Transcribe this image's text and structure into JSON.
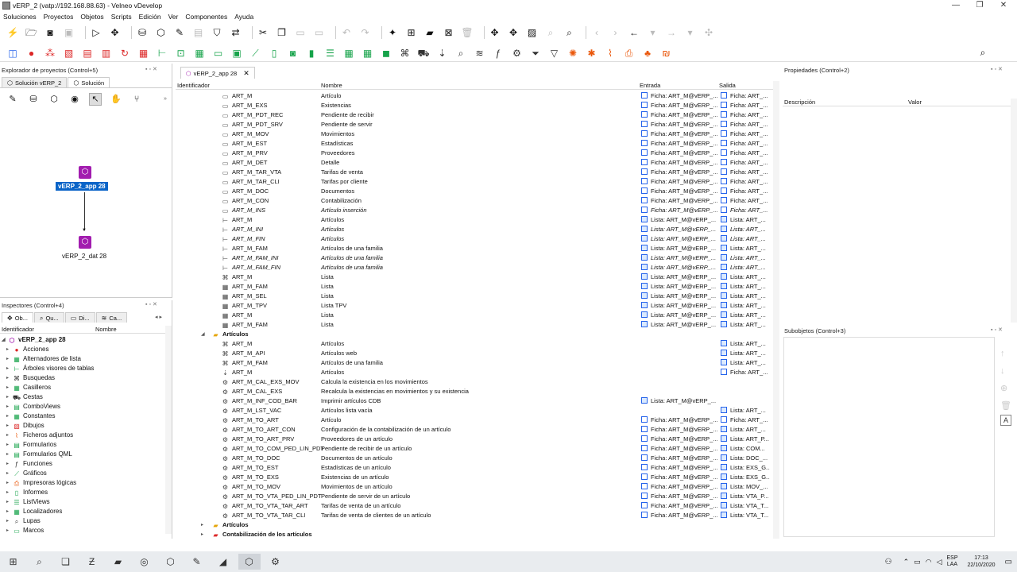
{
  "window": {
    "title": "vERP_2 (vatp://192.168.88.63) - Velneo vDevelop",
    "minimize": "—",
    "maximize": "❐",
    "close": "✕"
  },
  "menu": [
    "Soluciones",
    "Proyectos",
    "Objetos",
    "Scripts",
    "Edición",
    "Ver",
    "Componentes",
    "Ayuda"
  ],
  "toolbar1": [
    {
      "n": "lightning-icon",
      "g": "⚡"
    },
    {
      "n": "folder-open-icon",
      "g": "🗁"
    },
    {
      "n": "camera-icon",
      "g": "◙"
    },
    {
      "n": "save-all-icon",
      "g": "▣",
      "d": true
    },
    {
      "n": "sep"
    },
    {
      "n": "play-icon",
      "g": "▷"
    },
    {
      "n": "puzzle-icon",
      "g": "✥"
    },
    {
      "n": "sep"
    },
    {
      "n": "database-icon",
      "g": "⛁"
    },
    {
      "n": "hexagon-icon",
      "g": "⬡"
    },
    {
      "n": "edit-icon",
      "g": "✎"
    },
    {
      "n": "disk-icon",
      "g": "▤",
      "d": true
    },
    {
      "n": "shield-icon",
      "g": "⛉"
    },
    {
      "n": "exchange-icon",
      "g": "⇄"
    },
    {
      "n": "sep"
    },
    {
      "n": "cut-icon",
      "g": "✂"
    },
    {
      "n": "copy-icon",
      "g": "❐"
    },
    {
      "n": "paste-icon",
      "g": "▭",
      "d": true
    },
    {
      "n": "paste-special-icon",
      "g": "▭",
      "d": true
    },
    {
      "n": "sep"
    },
    {
      "n": "undo-icon",
      "g": "↶",
      "d": true
    },
    {
      "n": "redo-icon",
      "g": "↷",
      "d": true
    },
    {
      "n": "sep"
    },
    {
      "n": "magic-wand-icon",
      "g": "✦"
    },
    {
      "n": "folder-add-icon",
      "g": "⊞"
    },
    {
      "n": "folders-icon",
      "g": "▰"
    },
    {
      "n": "folder-remove-icon",
      "g": "⊠"
    },
    {
      "n": "trash-icon",
      "g": "🗑",
      "d": true
    },
    {
      "n": "sep"
    },
    {
      "n": "puzzle-add-icon",
      "g": "✥"
    },
    {
      "n": "puzzle-remove-icon",
      "g": "✥"
    },
    {
      "n": "image-icon",
      "g": "▨"
    },
    {
      "n": "zoom-icon",
      "g": "⌕",
      "d": true
    },
    {
      "n": "find-object-icon",
      "g": "⌕"
    },
    {
      "n": "sep"
    },
    {
      "n": "nav-first-icon",
      "g": "‹",
      "d": true
    },
    {
      "n": "nav-next-icon",
      "g": "›",
      "d": true
    },
    {
      "n": "back-icon",
      "g": "←"
    },
    {
      "n": "back-menu-icon",
      "g": "▾",
      "d": true
    },
    {
      "n": "forward-icon",
      "g": "→",
      "d": true
    },
    {
      "n": "forward-menu-icon",
      "g": "▾",
      "d": true
    },
    {
      "n": "move-icon",
      "g": "✣",
      "d": true
    }
  ],
  "toolbar2": [
    {
      "n": "object-icon",
      "g": "◫",
      "c": "#2563eb"
    },
    {
      "n": "record-icon",
      "g": "●",
      "c": "#dc2626"
    },
    {
      "n": "process-icon",
      "g": "⁂",
      "c": "#dc2626"
    },
    {
      "n": "picture-icon",
      "g": "▧",
      "c": "#dc2626"
    },
    {
      "n": "form-icon",
      "g": "▤",
      "c": "#dc2626"
    },
    {
      "n": "list-form-icon",
      "g": "▥",
      "c": "#dc2626"
    },
    {
      "n": "refresh-icon",
      "g": "↻",
      "c": "#dc2626"
    },
    {
      "n": "grid-icon",
      "g": "▦",
      "c": "#dc2626"
    },
    {
      "n": "tree-icon",
      "g": "⊢",
      "c": "#16a34a"
    },
    {
      "n": "dock-icon",
      "g": "⊡",
      "c": "#16a34a"
    },
    {
      "n": "table-icon",
      "g": "▦",
      "c": "#16a34a"
    },
    {
      "n": "frame-icon",
      "g": "▭",
      "c": "#16a34a"
    },
    {
      "n": "panel-icon",
      "g": "▣",
      "c": "#16a34a"
    },
    {
      "n": "chart-icon",
      "g": "⟋",
      "c": "#16a34a"
    },
    {
      "n": "document-icon",
      "g": "▯",
      "c": "#16a34a"
    },
    {
      "n": "query-icon",
      "g": "◙",
      "c": "#16a34a"
    },
    {
      "n": "slider-icon",
      "g": "▮",
      "c": "#16a34a"
    },
    {
      "n": "list-icon",
      "g": "☰",
      "c": "#16a34a"
    },
    {
      "n": "grid-list-icon",
      "g": "▦",
      "c": "#16a34a"
    },
    {
      "n": "matrix-icon",
      "g": "▦",
      "c": "#16a34a"
    },
    {
      "n": "cube-icon",
      "g": "◼",
      "c": "#16a34a"
    },
    {
      "n": "binoculars-icon",
      "g": "⌘",
      "c": "#333"
    },
    {
      "n": "basket-icon",
      "g": "⛟",
      "c": "#333"
    },
    {
      "n": "pin-icon",
      "g": "⇣",
      "c": "#333"
    },
    {
      "n": "search-icon",
      "g": "⌕",
      "c": "#333"
    },
    {
      "n": "layers-icon",
      "g": "≋",
      "c": "#333"
    },
    {
      "n": "function-icon",
      "g": "ƒ",
      "c": "#333"
    },
    {
      "n": "gear-icon",
      "g": "⚙",
      "c": "#333"
    },
    {
      "n": "filter-icon",
      "g": "⏷",
      "c": "#333"
    },
    {
      "n": "funnel-icon",
      "g": "▽",
      "c": "#333"
    },
    {
      "n": "sun-icon",
      "g": "✺",
      "c": "#ea580c"
    },
    {
      "n": "tool-icon",
      "g": "✱",
      "c": "#ea580c"
    },
    {
      "n": "attachment-icon",
      "g": "⌇",
      "c": "#ea580c"
    },
    {
      "n": "printer-icon",
      "g": "⎙",
      "c": "#ea580c"
    },
    {
      "n": "group-icon",
      "g": "♣",
      "c": "#ea580c"
    },
    {
      "n": "currency-icon",
      "g": "₪",
      "c": "#ea580c"
    }
  ],
  "project_explorer": {
    "title": "Explorador de proyectos (Control+5)",
    "tabs": [
      "Solución vERP_2",
      "Solución"
    ],
    "tools": [
      {
        "n": "edit-icon",
        "g": "✎"
      },
      {
        "n": "database-icon",
        "g": "⛁"
      },
      {
        "n": "hexagon-icon",
        "g": "⬡"
      },
      {
        "n": "eye-icon",
        "g": "◉"
      },
      {
        "n": "pointer-icon",
        "g": "↖"
      },
      {
        "n": "hand-icon",
        "g": "✋"
      },
      {
        "n": "branch-icon",
        "g": "⑂"
      }
    ],
    "node_app": "vERP_2_app 28",
    "node_dat": "vERP_2_dat 28"
  },
  "inspectors": {
    "title": "Inspectores (Control+4)",
    "tabs": [
      "Ob...",
      "Qu...",
      "Di...",
      "Ca..."
    ],
    "columns": [
      "Identificador",
      "Nombre"
    ],
    "root": "vERP_2_app 28",
    "items": [
      {
        "label": "Acciones",
        "icon": "●",
        "color": "#dc2626"
      },
      {
        "label": "Alternadores de lista",
        "icon": "▦",
        "color": "#16a34a"
      },
      {
        "label": "Árboles visores de tablas",
        "icon": "⊢",
        "color": "#16a34a"
      },
      {
        "label": "Busquedas",
        "icon": "⌘",
        "color": "#333"
      },
      {
        "label": "Casilleros",
        "icon": "▦",
        "color": "#16a34a"
      },
      {
        "label": "Cestas",
        "icon": "⛟",
        "color": "#333"
      },
      {
        "label": "ComboViews",
        "icon": "▤",
        "color": "#16a34a"
      },
      {
        "label": "Constantes",
        "icon": "▦",
        "color": "#16a34a"
      },
      {
        "label": "Dibujos",
        "icon": "▧",
        "color": "#dc2626"
      },
      {
        "label": "Ficheros adjuntos",
        "icon": "⌇",
        "color": "#ea580c"
      },
      {
        "label": "Formularios",
        "icon": "▤",
        "color": "#16a34a"
      },
      {
        "label": "Formularios QML",
        "icon": "▤",
        "color": "#16a34a"
      },
      {
        "label": "Funciones",
        "icon": "ƒ",
        "color": "#333"
      },
      {
        "label": "Gráficos",
        "icon": "⟋",
        "color": "#16a34a"
      },
      {
        "label": "Impresoras lógicas",
        "icon": "⎙",
        "color": "#ea580c"
      },
      {
        "label": "Informes",
        "icon": "▯",
        "color": "#16a34a"
      },
      {
        "label": "ListViews",
        "icon": "☰",
        "color": "#16a34a"
      },
      {
        "label": "Localizadores",
        "icon": "▦",
        "color": "#16a34a"
      },
      {
        "label": "Lupas",
        "icon": "⌕",
        "color": "#333"
      },
      {
        "label": "Marcos",
        "icon": "▭",
        "color": "#16a34a"
      }
    ]
  },
  "main": {
    "doc_tab": "vERP_2_app 28",
    "columns": {
      "id": "Identificador",
      "name": "Nombre",
      "in": "Entrada",
      "out": "Salida"
    },
    "rows": [
      {
        "ind": 3,
        "ic": "▭",
        "id": "ART_M",
        "nm": "Artículo",
        "en": "Ficha: ART_M@vERP_...",
        "sa": "Ficha: ART_..."
      },
      {
        "ind": 3,
        "ic": "▭",
        "id": "ART_M_EXS",
        "nm": "Existencias",
        "en": "Ficha: ART_M@vERP_...",
        "sa": "Ficha: ART_..."
      },
      {
        "ind": 3,
        "ic": "▭",
        "id": "ART_M_PDT_REC",
        "nm": "Pendiente de recibir",
        "en": "Ficha: ART_M@vERP_...",
        "sa": "Ficha: ART_..."
      },
      {
        "ind": 3,
        "ic": "▭",
        "id": "ART_M_PDT_SRV",
        "nm": "Pendiente de servir",
        "en": "Ficha: ART_M@vERP_...",
        "sa": "Ficha: ART_..."
      },
      {
        "ind": 3,
        "ic": "▭",
        "id": "ART_M_MOV",
        "nm": "Movimientos",
        "en": "Ficha: ART_M@vERP_...",
        "sa": "Ficha: ART_..."
      },
      {
        "ind": 3,
        "ic": "▭",
        "id": "ART_M_EST",
        "nm": "Estadísticas",
        "en": "Ficha: ART_M@vERP_...",
        "sa": "Ficha: ART_..."
      },
      {
        "ind": 3,
        "ic": "▭",
        "id": "ART_M_PRV",
        "nm": "Proveedores",
        "en": "Ficha: ART_M@vERP_...",
        "sa": "Ficha: ART_..."
      },
      {
        "ind": 3,
        "ic": "▭",
        "id": "ART_M_DET",
        "nm": "Detalle",
        "en": "Ficha: ART_M@vERP_...",
        "sa": "Ficha: ART_..."
      },
      {
        "ind": 3,
        "ic": "▭",
        "id": "ART_M_TAR_VTA",
        "nm": "Tarifas de venta",
        "en": "Ficha: ART_M@vERP_...",
        "sa": "Ficha: ART_..."
      },
      {
        "ind": 3,
        "ic": "▭",
        "id": "ART_M_TAR_CLI",
        "nm": "Tarifas por cliente",
        "en": "Ficha: ART_M@vERP_...",
        "sa": "Ficha: ART_..."
      },
      {
        "ind": 3,
        "ic": "▭",
        "id": "ART_M_DOC",
        "nm": "Documentos",
        "en": "Ficha: ART_M@vERP_...",
        "sa": "Ficha: ART_..."
      },
      {
        "ind": 3,
        "ic": "▭",
        "id": "ART_M_CON",
        "nm": "Contabilización",
        "en": "Ficha: ART_M@vERP_...",
        "sa": "Ficha: ART_..."
      },
      {
        "ind": 3,
        "ic": "▭",
        "id": "ART_M_INS",
        "nm": "Artículo inserción",
        "en": "Ficha: ART_M@vERP_...",
        "sa": "Ficha: ART_...",
        "it": true
      },
      {
        "ind": 3,
        "ic": "⊢",
        "id": "ART_M",
        "nm": "Artículos",
        "en": "Lista: ART_M@vERP_...",
        "sa": "Lista: ART_...",
        "f": true
      },
      {
        "ind": 3,
        "ic": "⊢",
        "id": "ART_M_INI",
        "nm": "Artículos",
        "en": "Lista: ART_M@vERP_...",
        "sa": "Lista: ART_...",
        "it": true,
        "f": true
      },
      {
        "ind": 3,
        "ic": "⊢",
        "id": "ART_M_FIN",
        "nm": "Artículos",
        "en": "Lista: ART_M@vERP_...",
        "sa": "Lista: ART_...",
        "it": true,
        "f": true
      },
      {
        "ind": 3,
        "ic": "⊢",
        "id": "ART_M_FAM",
        "nm": "Artículos de una familia",
        "en": "Lista: ART_M@vERP_...",
        "sa": "Lista: ART_...",
        "f": true
      },
      {
        "ind": 3,
        "ic": "⊢",
        "id": "ART_M_FAM_INI",
        "nm": "Artículos de una familia",
        "en": "Lista: ART_M@vERP_...",
        "sa": "Lista: ART_...",
        "it": true,
        "f": true
      },
      {
        "ind": 3,
        "ic": "⊢",
        "id": "ART_M_FAM_FIN",
        "nm": "Artículos de una familia",
        "en": "Lista: ART_M@vERP_...",
        "sa": "Lista: ART_...",
        "it": true,
        "f": true
      },
      {
        "ind": 3,
        "ic": "⌘",
        "id": "ART_M",
        "nm": "Lista",
        "en": "Lista: ART_M@vERP_...",
        "sa": "Lista: ART_...",
        "f": true
      },
      {
        "ind": 3,
        "ic": "▦",
        "id": "ART_M_FAM",
        "nm": "Lista",
        "en": "Lista: ART_M@vERP_...",
        "sa": "Lista: ART_...",
        "f": true
      },
      {
        "ind": 3,
        "ic": "▦",
        "id": "ART_M_SEL",
        "nm": "Lista",
        "en": "Lista: ART_M@vERP_...",
        "sa": "Lista: ART_...",
        "f": true
      },
      {
        "ind": 3,
        "ic": "▦",
        "id": "ART_M_TPV",
        "nm": "Lista TPV",
        "en": "Lista: ART_M@vERP_...",
        "sa": "Lista: ART_...",
        "f": true
      },
      {
        "ind": 3,
        "ic": "▦",
        "id": "ART_M",
        "nm": "Lista",
        "en": "Lista: ART_M@vERP_...",
        "sa": "Lista: ART_...",
        "f": true
      },
      {
        "ind": 3,
        "ic": "▦",
        "id": "ART_M_FAM",
        "nm": "Lista",
        "en": "Lista: ART_M@vERP_...",
        "sa": "Lista: ART_...",
        "f": true
      },
      {
        "ind": 2,
        "ic": "▰",
        "id": "Artículos",
        "nm": "",
        "en": "",
        "sa": "",
        "folder": true,
        "open": true
      },
      {
        "ind": 3,
        "ic": "⌘",
        "id": "ART_M",
        "nm": "Artículos",
        "en": "",
        "sa": "Lista: ART_...",
        "f": true
      },
      {
        "ind": 3,
        "ic": "⌘",
        "id": "ART_M_API",
        "nm": "Artículos web",
        "en": "",
        "sa": "Lista: ART_...",
        "f": true
      },
      {
        "ind": 3,
        "ic": "⌘",
        "id": "ART_M_FAM",
        "nm": "Artículos de una familia",
        "en": "",
        "sa": "Lista: ART_...",
        "f": true
      },
      {
        "ind": 3,
        "ic": "⇣",
        "id": "ART_M",
        "nm": "Artículos",
        "en": "",
        "sa": "Ficha: ART_..."
      },
      {
        "ind": 3,
        "ic": "⚙",
        "id": "ART_M_CAL_EXS_MOV",
        "nm": "Calcula la existencia en los movimientos",
        "en": "",
        "sa": ""
      },
      {
        "ind": 3,
        "ic": "⚙",
        "id": "ART_M_CAL_EXS",
        "nm": "Recalcula la existencias en movimientos y su existencia",
        "en": "",
        "sa": ""
      },
      {
        "ind": 3,
        "ic": "⚙",
        "id": "ART_M_INF_COD_BAR",
        "nm": "Imprimir artículos CDB",
        "en": "Lista: ART_M@vERP_...",
        "sa": "",
        "f": true
      },
      {
        "ind": 3,
        "ic": "⚙",
        "id": "ART_M_LST_VAC",
        "nm": "Artículos lista vacía",
        "en": "",
        "sa": "Lista: ART_...",
        "f": true
      },
      {
        "ind": 3,
        "ic": "⚙",
        "id": "ART_M_TO_ART",
        "nm": "Artículo",
        "en": "Ficha: ART_M@vERP_...",
        "sa": "Ficha: ART_..."
      },
      {
        "ind": 3,
        "ic": "⚙",
        "id": "ART_M_TO_ART_CON",
        "nm": "Configuración de la contabilización de un artículo",
        "en": "Ficha: ART_M@vERP_...",
        "sa": "Lista: ART_...",
        "f": true
      },
      {
        "ind": 3,
        "ic": "⚙",
        "id": "ART_M_TO_ART_PRV",
        "nm": "Proveedores de un artículo",
        "en": "Ficha: ART_M@vERP_...",
        "sa": "Lista: ART_P...",
        "f": true
      },
      {
        "ind": 3,
        "ic": "⚙",
        "id": "ART_M_TO_COM_PED_LIN_PDT",
        "nm": "Pendiente de recibir de un artículo",
        "en": "Ficha: ART_M@vERP_...",
        "sa": "Lista: COM...",
        "f": true
      },
      {
        "ind": 3,
        "ic": "⚙",
        "id": "ART_M_TO_DOC",
        "nm": "Documentos de un artículo",
        "en": "Ficha: ART_M@vERP_...",
        "sa": "Lista: DOC_...",
        "f": true
      },
      {
        "ind": 3,
        "ic": "⚙",
        "id": "ART_M_TO_EST",
        "nm": "Estadísticas de un artículo",
        "en": "Ficha: ART_M@vERP_...",
        "sa": "Lista: EXS_G...",
        "f": true
      },
      {
        "ind": 3,
        "ic": "⚙",
        "id": "ART_M_TO_EXS",
        "nm": "Existencias de un artículo",
        "en": "Ficha: ART_M@vERP_...",
        "sa": "Lista: EXS_G...",
        "f": true
      },
      {
        "ind": 3,
        "ic": "⚙",
        "id": "ART_M_TO_MOV",
        "nm": "Movimientos de un artículo",
        "en": "Ficha: ART_M@vERP_...",
        "sa": "Lista: MOV_...",
        "f": true
      },
      {
        "ind": 3,
        "ic": "⚙",
        "id": "ART_M_TO_VTA_PED_LIN_PDT",
        "nm": "Pendiente de servir de un artículo",
        "en": "Ficha: ART_M@vERP_...",
        "sa": "Lista: VTA_P...",
        "f": true
      },
      {
        "ind": 3,
        "ic": "⚙",
        "id": "ART_M_TO_VTA_TAR_ART",
        "nm": "Tarifas de venta de un artículo",
        "en": "Ficha: ART_M@vERP_...",
        "sa": "Lista: VTA_T...",
        "f": true
      },
      {
        "ind": 3,
        "ic": "⚙",
        "id": "ART_M_TO_VTA_TAR_CLI",
        "nm": "Tarifas de venta de clientes de un artículo",
        "en": "Ficha: ART_M@vERP_...",
        "sa": "Lista: VTA_T...",
        "f": true
      },
      {
        "ind": 2,
        "ic": "▰",
        "id": "Artículos",
        "nm": "",
        "en": "",
        "sa": "",
        "folder": true,
        "open": false
      },
      {
        "ind": 2,
        "ic": "▰",
        "id": "Contabilización de los artículos",
        "nm": "",
        "en": "",
        "sa": "",
        "folder": true,
        "open": false,
        "red": true
      }
    ]
  },
  "properties": {
    "title": "Propiedades (Control+2)",
    "columns": [
      "Descripción",
      "Valor"
    ]
  },
  "subobjects": {
    "title": "Subobjetos (Control+3)"
  },
  "taskbar": {
    "apps": [
      {
        "n": "windows-start-icon",
        "g": "⊞"
      },
      {
        "n": "search-icon",
        "g": "⌕"
      },
      {
        "n": "task-view-icon",
        "g": "❏"
      },
      {
        "n": "filezilla-icon",
        "g": "Ƶ"
      },
      {
        "n": "explorer-icon",
        "g": "▰"
      },
      {
        "n": "chrome-icon",
        "g": "◎"
      },
      {
        "n": "velneo-icon",
        "g": "⬡"
      },
      {
        "n": "app-icon",
        "g": "✎"
      },
      {
        "n": "app2-icon",
        "g": "◢"
      },
      {
        "n": "vdevelop-icon",
        "g": "⬡"
      },
      {
        "n": "settings-icon",
        "g": "⚙"
      }
    ],
    "lang": "ESP",
    "lang2": "LAA",
    "time": "17:13",
    "date": "22/10/2020"
  },
  "colors": {
    "accent": "#0078d7",
    "node": "#a21caf",
    "selection": "#0a64c8"
  }
}
